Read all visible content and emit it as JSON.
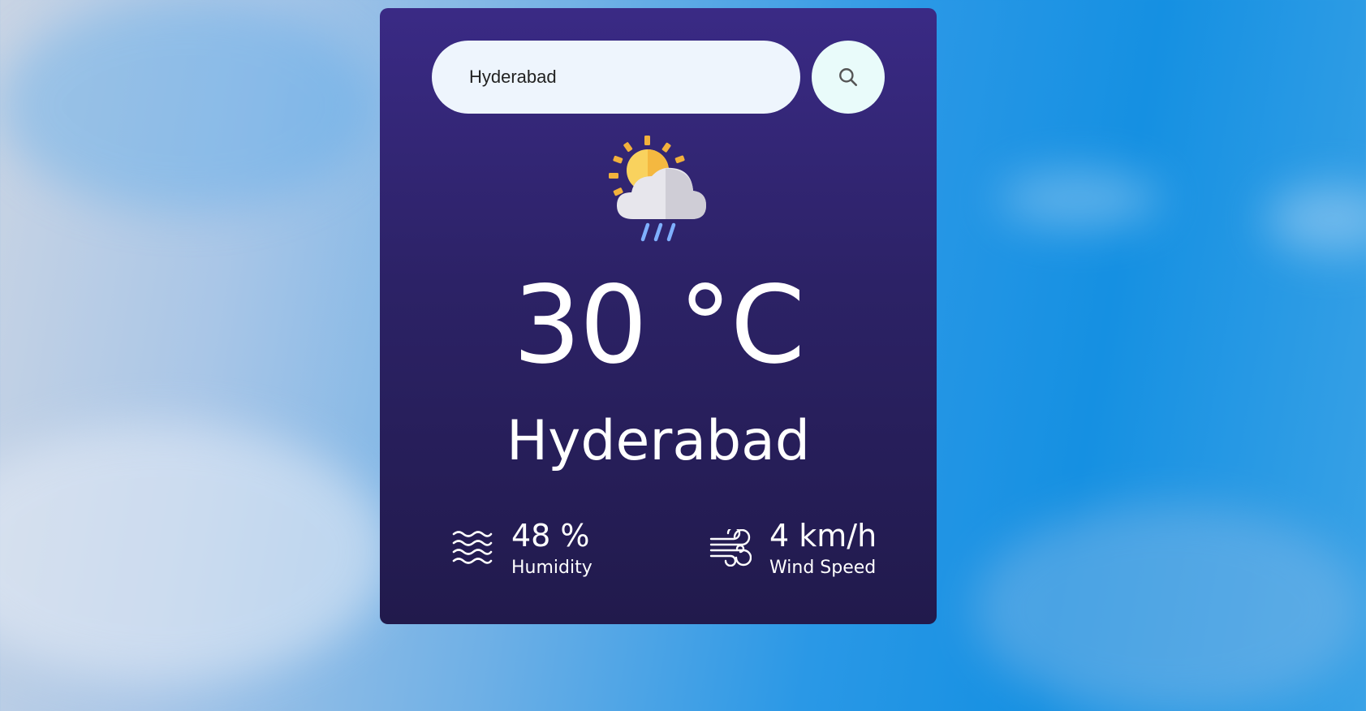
{
  "search": {
    "value": "Hyderabad",
    "button_icon": "search-icon"
  },
  "weather": {
    "condition_icon": "partly-cloudy-rain-icon",
    "temperature": "30 °C",
    "city": "Hyderabad"
  },
  "details": {
    "humidity": {
      "icon": "humidity-waves-icon",
      "value": "48 %",
      "label": "Humidity"
    },
    "wind": {
      "icon": "wind-icon",
      "value": "4 km/h",
      "label": "Wind Speed"
    }
  },
  "colors": {
    "card_top": "#3a2a85",
    "card_bottom": "#211a4c",
    "sun": "#f9c74f",
    "cloud": "#e6e6ea",
    "rain": "#7fb0ff"
  }
}
